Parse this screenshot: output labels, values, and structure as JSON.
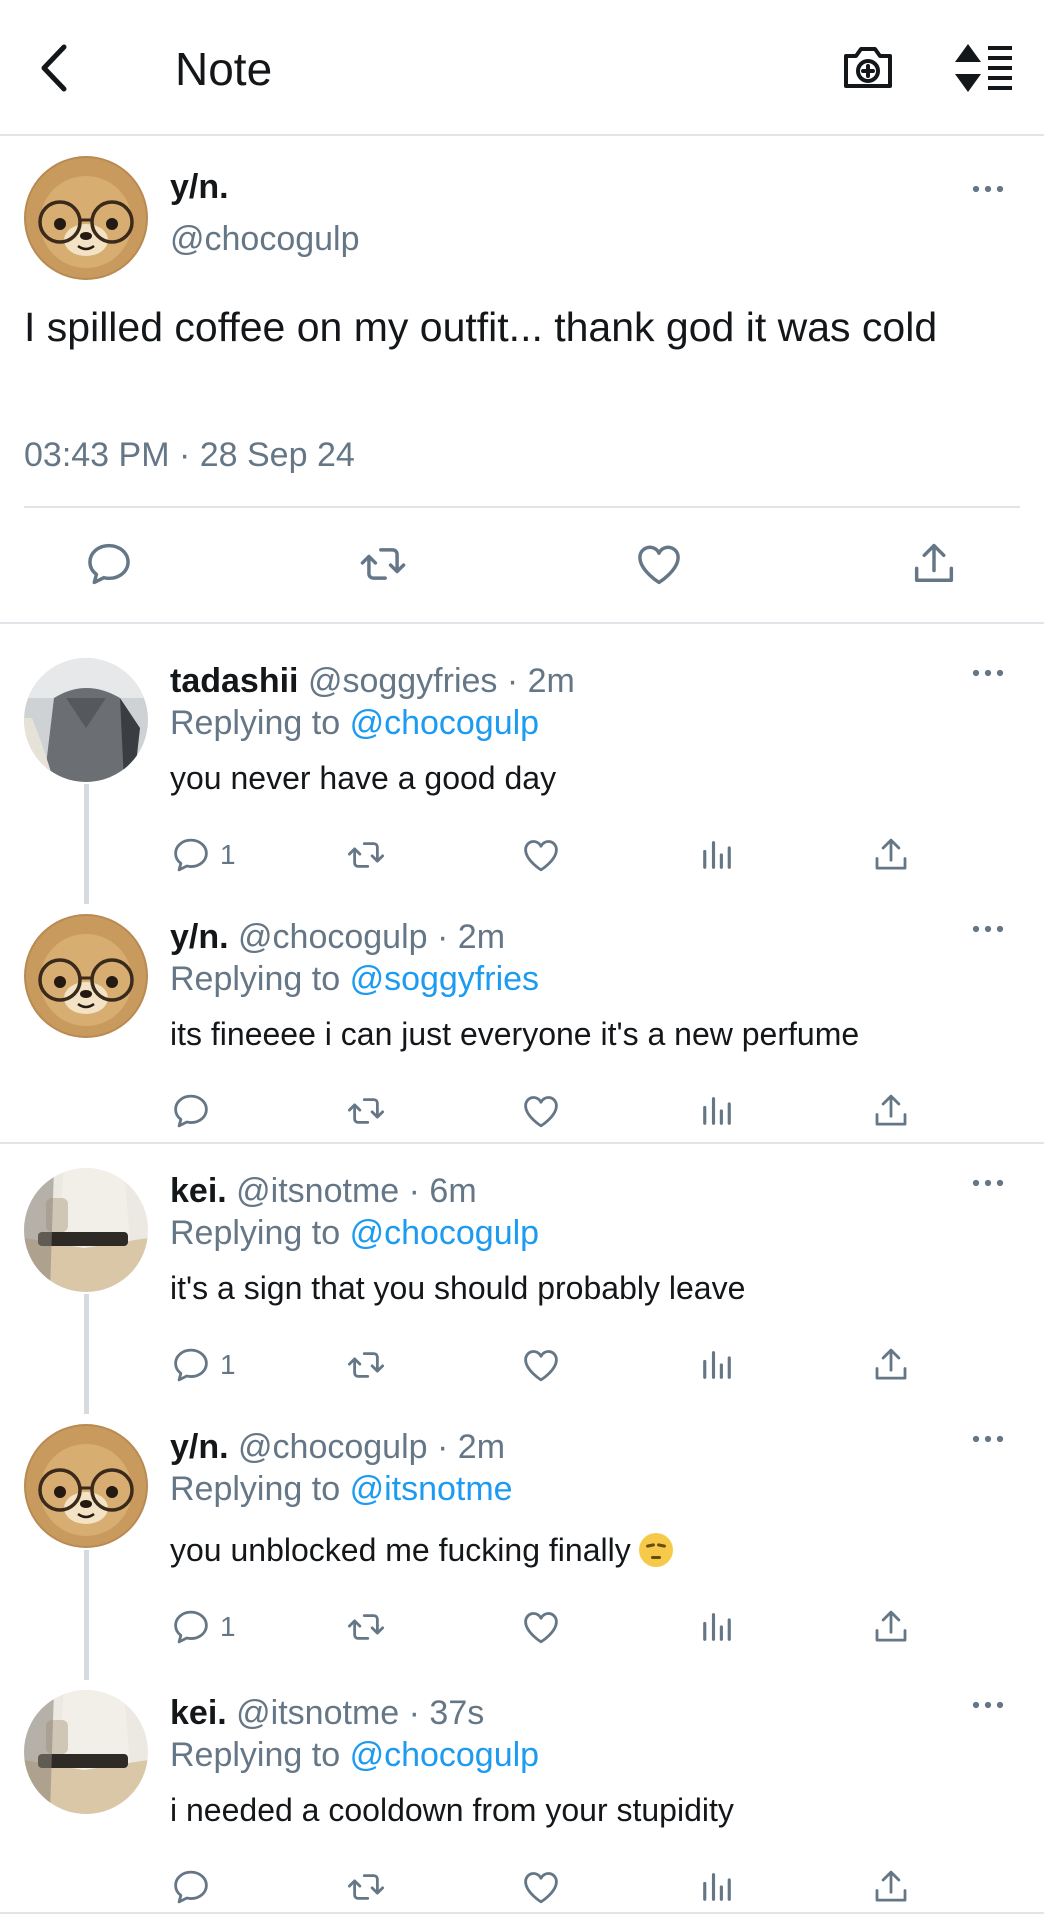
{
  "header": {
    "back_icon": "chevron-left-icon",
    "title": "Note",
    "camera_icon": "camera-plus-icon",
    "sort_icon": "sort-list-icon"
  },
  "main_tweet": {
    "name": "y/n.",
    "handle": "@chocogulp",
    "text": "I spilled coffee on my outfit... thank god it was cold",
    "timestamp": "03:43 PM · 28 Sep 24",
    "more_icon": "more-dots-icon",
    "actions": [
      "reply-icon",
      "retweet-icon",
      "like-icon",
      "share-icon"
    ]
  },
  "replies": [
    {
      "name": "tadashii",
      "handle": "@soggyfries",
      "time": "· 2m",
      "replying_prefix": "Replying to",
      "replying_to": "@chocogulp",
      "text": "you never have a good day",
      "reply_count": "1",
      "avatar": "person-photo"
    },
    {
      "name": "y/n.",
      "handle": "@chocogulp",
      "time": "· 2m",
      "replying_prefix": "Replying to",
      "replying_to": "@soggyfries",
      "text": "its fineeee i can just everyone it's a new perfume",
      "reply_count": "",
      "avatar": "bear-with-glasses"
    },
    {
      "name": "kei.",
      "handle": "@itsnotme",
      "time": "· 6m",
      "replying_prefix": "Replying to",
      "replying_to": "@chocogulp",
      "text": "it's a sign that you should probably leave",
      "reply_count": "1",
      "avatar": "person-photo-2"
    },
    {
      "name": "y/n.",
      "handle": "@chocogulp",
      "time": "· 2m",
      "replying_prefix": "Replying to",
      "replying_to": "@itsnotme",
      "text": "you unblocked me fucking finally",
      "emoji": "unamused-face",
      "reply_count": "1",
      "avatar": "bear-with-glasses"
    },
    {
      "name": "kei.",
      "handle": "@itsnotme",
      "time": "· 37s",
      "replying_prefix": "Replying to",
      "replying_to": "@chocogulp",
      "text": "i needed a cooldown from your stupidity",
      "reply_count": "",
      "avatar": "person-photo-2"
    }
  ],
  "colors": {
    "text": "#14171a",
    "secondary": "#657786",
    "link": "#1d9bf0",
    "divider": "#e1e4e8",
    "thread_line": "#d6dbe0"
  }
}
